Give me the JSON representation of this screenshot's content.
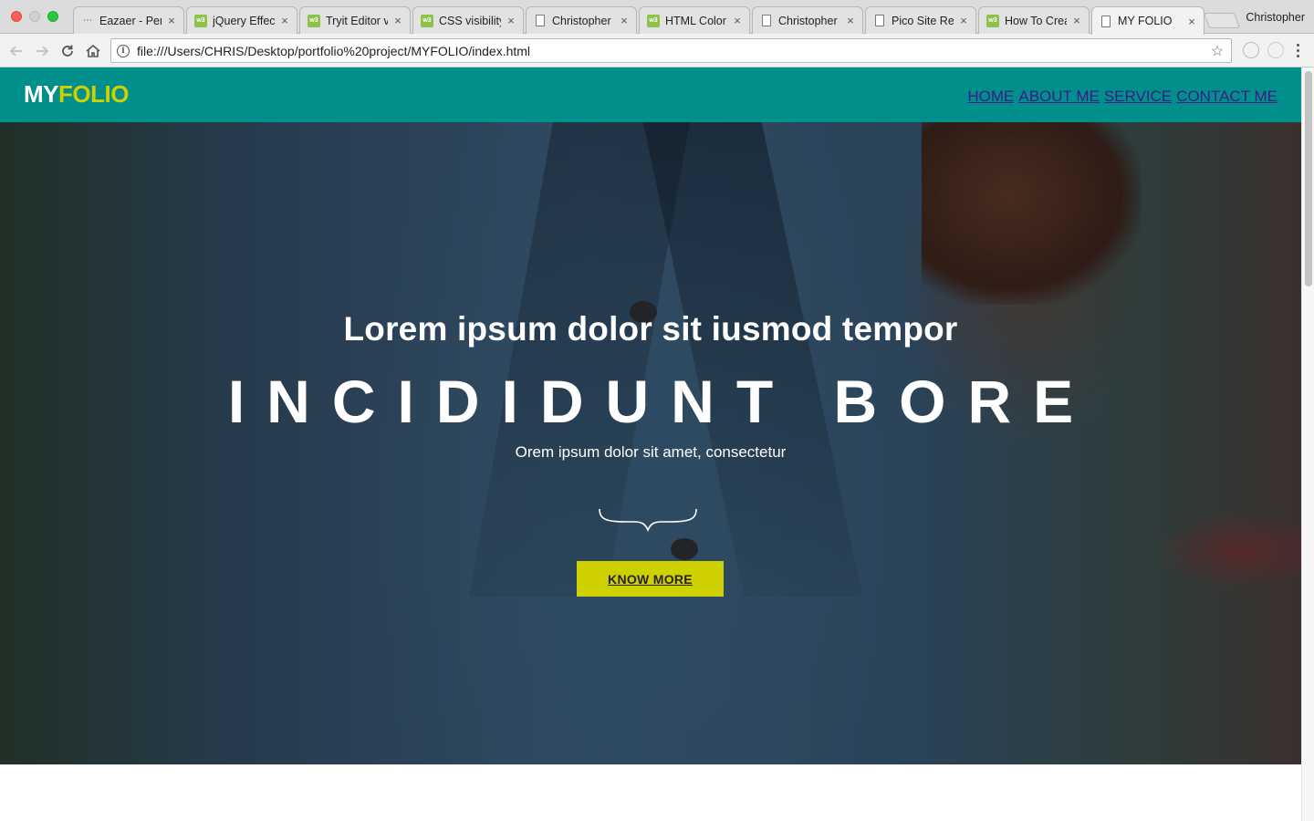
{
  "browser": {
    "tabs": [
      {
        "title": "Eazaer - Per",
        "favicon": "dots"
      },
      {
        "title": "jQuery Effec",
        "favicon": "w3"
      },
      {
        "title": "Tryit Editor v",
        "favicon": "w3"
      },
      {
        "title": "CSS visibility",
        "favicon": "w3"
      },
      {
        "title": "Christopher",
        "favicon": "doc"
      },
      {
        "title": "HTML Color",
        "favicon": "w3"
      },
      {
        "title": "Christopher",
        "favicon": "doc"
      },
      {
        "title": "Pico Site Rep",
        "favicon": "doc"
      },
      {
        "title": "How To Crea",
        "favicon": "w3"
      },
      {
        "title": "MY FOLIO",
        "favicon": "doc",
        "active": true
      }
    ],
    "tab_close_glyph": "×",
    "w3_favicon_text": "w3",
    "profile_name": "Christopher",
    "url": "file:///Users/CHRIS/Desktop/portfolio%20project/MYFOLIO/index.html",
    "icons": {
      "back": "arrow-left-icon",
      "forward": "arrow-right-icon",
      "reload": "reload-icon",
      "home": "home-icon",
      "info": "info-icon",
      "bookmark": "star-icon",
      "menu": "more-vert-icon"
    }
  },
  "site": {
    "logo": {
      "part1": "MY",
      "part2": "FOLIO"
    },
    "nav": [
      "HOME",
      "ABOUT ME",
      "SERVICE",
      "CONTACT ME"
    ],
    "hero": {
      "title": "Lorem ipsum dolor sit iusmod tempor",
      "big_title": "INCIDIDUNT BORE",
      "subtitle": "Orem ipsum dolor sit amet, consectetur",
      "cta": "KNOW MORE"
    },
    "colors": {
      "header_bg": "#008f8b",
      "accent": "#cfd000",
      "nav_link": "#3b1a8a"
    }
  }
}
